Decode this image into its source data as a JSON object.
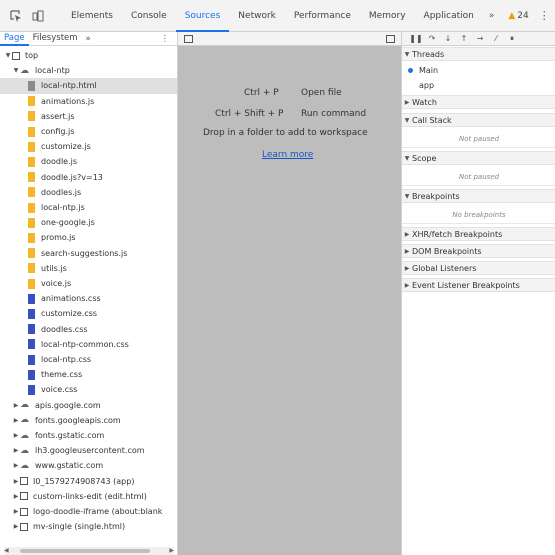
{
  "toolbar": {
    "tabs": [
      "Elements",
      "Console",
      "Sources",
      "Network",
      "Performance",
      "Memory",
      "Application"
    ],
    "more": "»",
    "warnings_count": "24"
  },
  "navigator": {
    "tabs": [
      "Page",
      "Filesystem"
    ],
    "more": "»",
    "tree": [
      {
        "label": "top",
        "type": "frame",
        "indent": 0,
        "expanded": true
      },
      {
        "label": "local-ntp",
        "type": "cloud",
        "indent": 1,
        "expanded": true
      },
      {
        "label": "local-ntp.html",
        "type": "html",
        "indent": 2,
        "selected": true
      },
      {
        "label": "animations.js",
        "type": "js",
        "indent": 2
      },
      {
        "label": "assert.js",
        "type": "js",
        "indent": 2
      },
      {
        "label": "config.js",
        "type": "js",
        "indent": 2
      },
      {
        "label": "customize.js",
        "type": "js",
        "indent": 2
      },
      {
        "label": "doodle.js",
        "type": "js",
        "indent": 2
      },
      {
        "label": "doodle.js?v=13",
        "type": "js",
        "indent": 2
      },
      {
        "label": "doodles.js",
        "type": "js",
        "indent": 2
      },
      {
        "label": "local-ntp.js",
        "type": "js",
        "indent": 2
      },
      {
        "label": "one-google.js",
        "type": "js",
        "indent": 2
      },
      {
        "label": "promo.js",
        "type": "js",
        "indent": 2
      },
      {
        "label": "search-suggestions.js",
        "type": "js",
        "indent": 2
      },
      {
        "label": "utils.js",
        "type": "js",
        "indent": 2
      },
      {
        "label": "voice.js",
        "type": "js",
        "indent": 2
      },
      {
        "label": "animations.css",
        "type": "css",
        "indent": 2
      },
      {
        "label": "customize.css",
        "type": "css",
        "indent": 2
      },
      {
        "label": "doodles.css",
        "type": "css",
        "indent": 2
      },
      {
        "label": "local-ntp-common.css",
        "type": "css",
        "indent": 2
      },
      {
        "label": "local-ntp.css",
        "type": "css",
        "indent": 2
      },
      {
        "label": "theme.css",
        "type": "css",
        "indent": 2
      },
      {
        "label": "voice.css",
        "type": "css",
        "indent": 2
      },
      {
        "label": "apis.google.com",
        "type": "cloud",
        "indent": 1,
        "expanded": false
      },
      {
        "label": "fonts.googleapis.com",
        "type": "cloud",
        "indent": 1,
        "expanded": false
      },
      {
        "label": "fonts.gstatic.com",
        "type": "cloud",
        "indent": 1,
        "expanded": false
      },
      {
        "label": "lh3.googleusercontent.com",
        "type": "cloud",
        "indent": 1,
        "expanded": false
      },
      {
        "label": "www.gstatic.com",
        "type": "cloud",
        "indent": 1,
        "expanded": false
      },
      {
        "label": "I0_1579274908743 (app)",
        "type": "frame",
        "indent": 1,
        "expanded": false
      },
      {
        "label": "custom-links-edit (edit.html)",
        "type": "frame",
        "indent": 1,
        "expanded": false
      },
      {
        "label": "logo-doodle-iframe (about:blank",
        "type": "frame",
        "indent": 1,
        "expanded": false
      },
      {
        "label": "mv-single (single.html)",
        "type": "frame",
        "indent": 1,
        "expanded": false
      }
    ]
  },
  "editor": {
    "shortcuts": [
      {
        "keys": "Ctrl + P",
        "action": "Open file"
      },
      {
        "keys": "Ctrl + Shift + P",
        "action": "Run command"
      }
    ],
    "drop_text": "Drop in a folder to add to workspace",
    "learn_more": "Learn more"
  },
  "debugger": {
    "threads": {
      "label": "Threads",
      "items": [
        "Main",
        "app"
      ]
    },
    "watch": "Watch",
    "call_stack": {
      "label": "Call Stack",
      "message": "Not paused"
    },
    "scope": {
      "label": "Scope",
      "message": "Not paused"
    },
    "breakpoints": {
      "label": "Breakpoints",
      "message": "No breakpoints"
    },
    "xhr": "XHR/fetch Breakpoints",
    "dom": "DOM Breakpoints",
    "global": "Global Listeners",
    "event": "Event Listener Breakpoints"
  },
  "colors": {
    "accent": "#1a73e8",
    "js": "#f5b729",
    "css": "#3a4fc0",
    "editor_bg": "#bdbdbd"
  }
}
